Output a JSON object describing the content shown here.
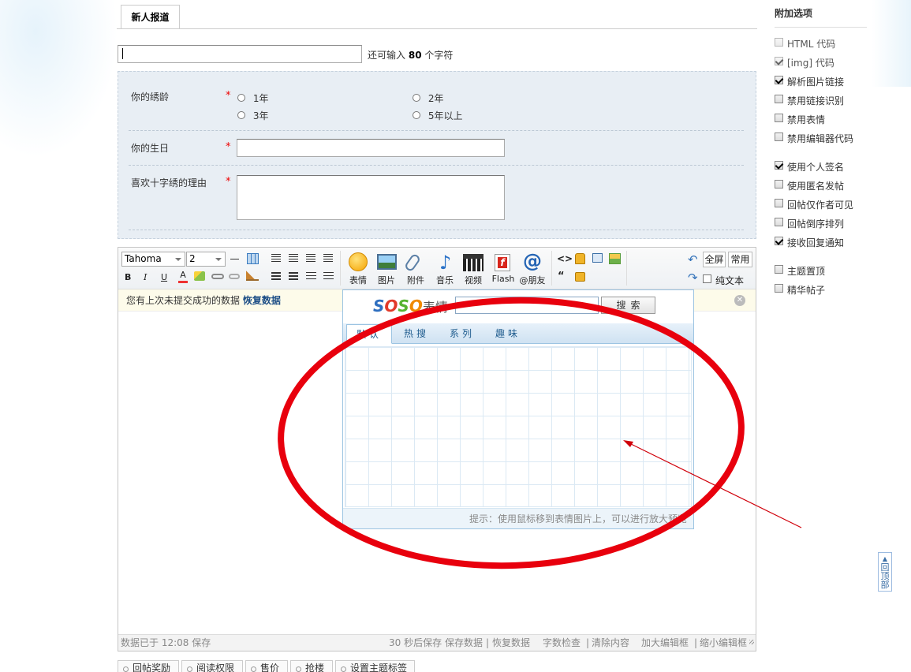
{
  "page_tab": "新人报道",
  "title_field": {
    "value": "",
    "counter_prefix": "还可输入",
    "counter_value": "80",
    "counter_suffix": "个字符"
  },
  "form": {
    "q1_label": "你的绣龄",
    "q1_options": [
      "1年",
      "2年",
      "3年",
      "5年以上"
    ],
    "q2_label": "你的生日",
    "q3_label": "喜欢十字绣的理由",
    "required_mark": "*"
  },
  "toolbar": {
    "font_family": "Tahoma",
    "font_size": "2",
    "format_icons": [
      "B",
      "I",
      "U",
      "A"
    ],
    "media": [
      {
        "label": "表情",
        "icon": "smiley-icon"
      },
      {
        "label": "图片",
        "icon": "image-icon"
      },
      {
        "label": "附件",
        "icon": "paperclip-icon"
      },
      {
        "label": "音乐",
        "icon": "music-icon"
      },
      {
        "label": "视频",
        "icon": "video-icon"
      },
      {
        "label": "Flash",
        "icon": "flash-icon"
      },
      {
        "label": "@朋友",
        "icon": "at-icon"
      }
    ],
    "fullscreen": "全屏",
    "common": "常用",
    "plaintext": "纯文本"
  },
  "restore_bar": {
    "text": "您有上次未提交成功的数据",
    "link": "恢复数据"
  },
  "emoji_popup": {
    "brand": "SOSO",
    "brand_suffix": "表情",
    "search_button": "搜索",
    "tabs": [
      "默认",
      "热搜",
      "系列",
      "趣味"
    ],
    "hint": "提示：使用鼠标移到表情图片上，可以进行放大预览"
  },
  "statusbar": {
    "saved": "数据已于 12:08 保存",
    "autosave": "30 秒后保存",
    "links": [
      "保存数据",
      "恢复数据",
      "字数检查",
      "清除内容",
      "加大编辑框",
      "缩小编辑框"
    ]
  },
  "sidebar": {
    "title": "附加选项",
    "group1": [
      {
        "label": "HTML 代码",
        "checked": false,
        "dim": true
      },
      {
        "label": "[img] 代码",
        "checked": true,
        "dim": true
      },
      {
        "label": "解析图片链接",
        "checked": true,
        "dim": false
      },
      {
        "label": "禁用链接识别",
        "checked": false,
        "dim": false
      },
      {
        "label": "禁用表情",
        "checked": false,
        "dim": false
      },
      {
        "label": "禁用编辑器代码",
        "checked": false,
        "dim": false
      }
    ],
    "group2": [
      {
        "label": "使用个人签名",
        "checked": true,
        "dim": false
      },
      {
        "label": "使用匿名发帖",
        "checked": false,
        "dim": false
      },
      {
        "label": "回帖仅作者可见",
        "checked": false,
        "dim": false
      },
      {
        "label": "回帖倒序排列",
        "checked": false,
        "dim": false
      },
      {
        "label": "接收回复通知",
        "checked": true,
        "dim": false
      }
    ],
    "group3": [
      {
        "label": "主题置顶",
        "checked": false,
        "dim": false
      },
      {
        "label": "精华帖子",
        "checked": false,
        "dim": false
      }
    ]
  },
  "bottom_tabs": [
    "回帖奖励",
    "阅读权限",
    "售价",
    "抢楼",
    "设置主题标签"
  ],
  "back_to_top": "回顶部",
  "colors": {
    "annotation": "#e8000d",
    "link": "#1d4e86",
    "soso_blue": "#2f6fc0",
    "soso_green": "#58b431",
    "soso_orange": "#f08a00"
  }
}
